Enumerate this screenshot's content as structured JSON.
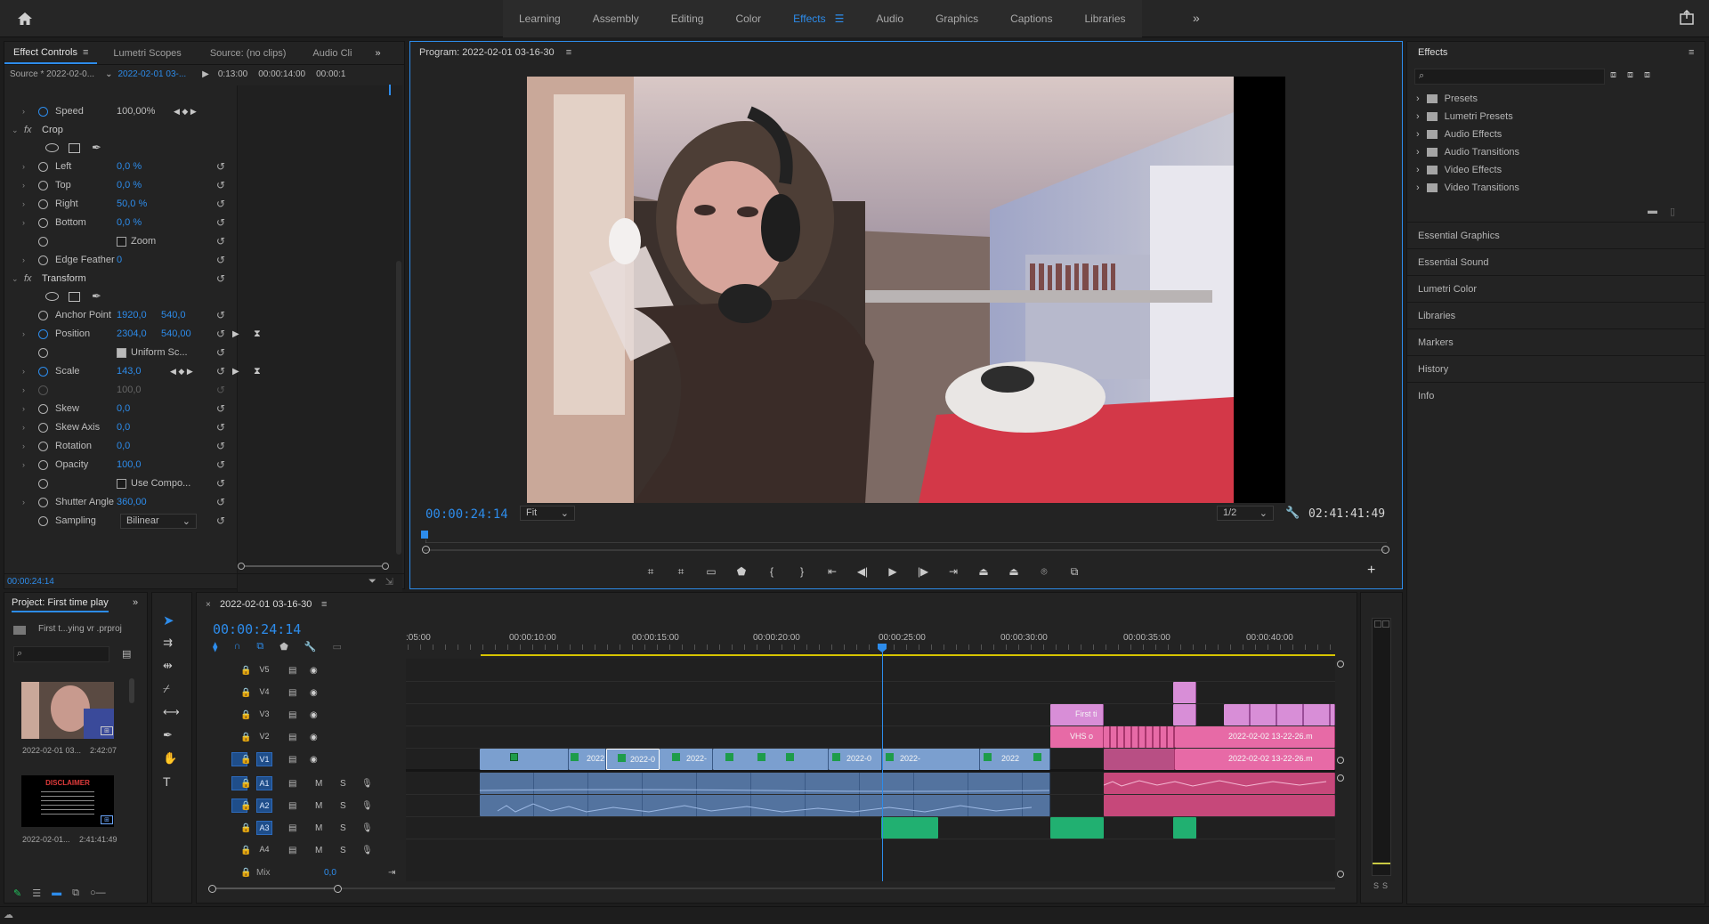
{
  "workspace": {
    "tabs": [
      "Learning",
      "Assembly",
      "Editing",
      "Color",
      "Effects",
      "Audio",
      "Graphics",
      "Captions",
      "Libraries"
    ],
    "active": "Effects",
    "more_label": "»"
  },
  "effect_controls": {
    "tabs": [
      "Effect Controls",
      "Lumetri Scopes",
      "Source: (no clips)",
      "Audio Cli"
    ],
    "source": "Source * 2022-02-0...",
    "sequence": "2022-02-01 03-...",
    "ruler": [
      "0:13:00",
      "00:00:14:00",
      "00:00:1"
    ],
    "speed": {
      "name": "Speed",
      "value": "100,00%"
    },
    "crop": {
      "title": "Crop",
      "left": {
        "name": "Left",
        "value": "0,0 %"
      },
      "top": {
        "name": "Top",
        "value": "0,0 %"
      },
      "right": {
        "name": "Right",
        "value": "50,0 %"
      },
      "bottom": {
        "name": "Bottom",
        "value": "0,0 %"
      },
      "zoom": "Zoom",
      "edge": {
        "name": "Edge Feather",
        "value": "0"
      }
    },
    "transform": {
      "title": "Transform",
      "anchor": {
        "name": "Anchor Point",
        "x": "1920,0",
        "y": "540,0"
      },
      "position": {
        "name": "Position",
        "x": "2304,0",
        "y": "540,00"
      },
      "uniform": "Uniform Sc...",
      "scale": {
        "name": "Scale",
        "value": "143,0"
      },
      "scale_w": "100,0",
      "skew": {
        "name": "Skew",
        "value": "0,0"
      },
      "skew_axis": {
        "name": "Skew Axis",
        "value": "0,0"
      },
      "rotation": {
        "name": "Rotation",
        "value": "0,0"
      },
      "opacity": {
        "name": "Opacity",
        "value": "100,0"
      },
      "use_comp": "Use Compo...",
      "shutter": {
        "name": "Shutter Angle",
        "value": "360,00"
      },
      "sampling": {
        "name": "Sampling",
        "value": "Bilinear"
      }
    },
    "timecode": "00:00:24:14"
  },
  "program": {
    "title": "Program: 2022-02-01 03-16-30",
    "timecode": "00:00:24:14",
    "fit": "Fit",
    "resolution": "1/2",
    "duration": "02:41:41:49"
  },
  "effects_panel": {
    "title": "Effects",
    "folders": [
      "Presets",
      "Lumetri Presets",
      "Audio Effects",
      "Audio Transitions",
      "Video Effects",
      "Video Transitions"
    ],
    "sections": [
      "Essential Graphics",
      "Essential Sound",
      "Lumetri Color",
      "Libraries",
      "Markers",
      "History",
      "Info"
    ]
  },
  "project": {
    "title": "Project: First time play",
    "file": "First t...ying vr .prproj",
    "items": [
      {
        "name": "2022-02-01 03...",
        "duration": "2:42:07"
      },
      {
        "name": "2022-02-01...",
        "duration": "2:41:41:49"
      }
    ],
    "disclaimer_title": "DISCLAIMER"
  },
  "timeline": {
    "sequence": "2022-02-01 03-16-30",
    "timecode": "00:00:24:14",
    "ruler": [
      ":05:00",
      "00:00:10:00",
      "00:00:15:00",
      "00:00:20:00",
      "00:00:25:00",
      "00:00:30:00",
      "00:00:35:00",
      "00:00:40:00"
    ],
    "video_tracks": [
      "V5",
      "V4",
      "V3",
      "V2",
      "V1"
    ],
    "audio_tracks": [
      "A1",
      "A2",
      "A3",
      "A4"
    ],
    "mix_label": "Mix",
    "mix_value": "0,0",
    "clip_labels": {
      "v1a": "2022",
      "v1b": "2022-0",
      "v1c": "2022-",
      "v1d": "2022-0",
      "v1e": "2022-",
      "v1f": "2022",
      "v3": "First ti",
      "v2": "VHS o",
      "v2r": "2022-02-02 13-22-26.m",
      "v1r": "2022-02-02 13-22-26.m"
    }
  },
  "meter": {
    "labels": [
      "S",
      "S"
    ]
  }
}
